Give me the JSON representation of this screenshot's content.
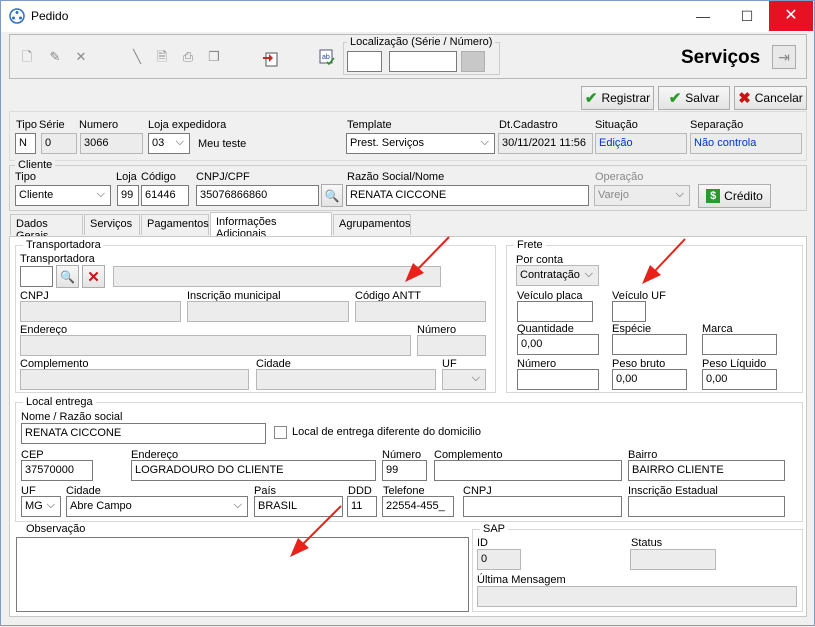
{
  "window": {
    "title": "Pedido",
    "minimize_glyph": "—",
    "maximize_glyph": "☐",
    "close_glyph": "✕"
  },
  "toolbar": {
    "localizacao_label": "Localização (Série / Número)",
    "module_title": "Serviços",
    "registrar": "Registrar",
    "salvar": "Salvar",
    "cancelar": "Cancelar"
  },
  "header": {
    "tipo_label": "Tipo",
    "tipo": "N",
    "serie_label": "Série",
    "serie": "0",
    "numero_label": "Numero",
    "numero": "3066",
    "loja_exp_label": "Loja expedidora",
    "loja_exp": "03",
    "loja_exp_name": "Meu teste",
    "template_label": "Template",
    "template": "Prest. Serviços",
    "dtcadastro_label": "Dt.Cadastro",
    "dtcadastro": "30/11/2021 11:56",
    "situacao_label": "Situação",
    "situacao": "Edição",
    "separacao_label": "Separação",
    "separacao": "Não controla"
  },
  "cliente": {
    "group_label": "Cliente",
    "tipo_label": "Tipo",
    "tipo": "Cliente",
    "loja_label": "Loja",
    "loja": "99",
    "codigo_label": "Código",
    "codigo": "61446",
    "cnpj_label": "CNPJ/CPF",
    "cnpj": "35076866860",
    "razao_label": "Razão Social/Nome",
    "razao": "RENATA CICCONE",
    "operacao_label": "Operação",
    "operacao": "Varejo",
    "credito": "Crédito"
  },
  "tabs": [
    "Dados Gerais",
    "Serviços",
    "Pagamentos",
    "Informações Adicionais",
    "Agrupamentos"
  ],
  "transportadora": {
    "group_label": "Transportadora",
    "transportadora_label": "Transportadora",
    "cnpj_label": "CNPJ",
    "insc_municipal_label": "Inscrição municipal",
    "codigo_antt_label": "Código ANTT",
    "endereco_label": "Endereço",
    "numero_label": "Número",
    "complemento_label": "Complemento",
    "cidade_label": "Cidade",
    "uf_label": "UF"
  },
  "frete": {
    "group_label": "Frete",
    "por_conta_label": "Por conta",
    "por_conta": "Contratação",
    "veiculo_placa_label": "Veículo placa",
    "veiculo_uf_label": "Veículo UF",
    "quantidade_label": "Quantidade",
    "quantidade": "0,00",
    "especie_label": "Espécie",
    "marca_label": "Marca",
    "numero_label": "Número",
    "peso_bruto_label": "Peso bruto",
    "peso_bruto": "0,00",
    "peso_liquido_label": "Peso Líquido",
    "peso_liquido": "0,00"
  },
  "local_entrega": {
    "group_label": "Local entrega",
    "nome_label": "Nome / Razão social",
    "nome": "RENATA CICCONE",
    "diferente_label": "Local de entrega diferente do domicilio",
    "cep_label": "CEP",
    "cep": "37570000",
    "endereco_label": "Endereço",
    "endereco": "LOGRADOURO DO CLIENTE",
    "numero_label": "Número",
    "numero": "99",
    "complemento_label": "Complemento",
    "bairro_label": "Bairro",
    "bairro": "BAIRRO CLIENTE",
    "uf_label": "UF",
    "uf": "MG",
    "cidade_label": "Cidade",
    "cidade": "Abre Campo",
    "pais_label": "País",
    "pais": "BRASIL",
    "ddd_label": "DDD",
    "ddd": "11",
    "telefone_label": "Telefone",
    "telefone": "22554-455_",
    "cnpj_label": "CNPJ",
    "insc_estadual_label": "Inscrição Estadual"
  },
  "observacao": {
    "group_label": "Observação"
  },
  "sap": {
    "group_label": "SAP",
    "id_label": "ID",
    "id": "0",
    "status_label": "Status",
    "ultima_label": "Última Mensagem"
  },
  "colors": {
    "arrow": "#e8221b",
    "accent_text": "#0033cc",
    "close": "#e81123"
  }
}
